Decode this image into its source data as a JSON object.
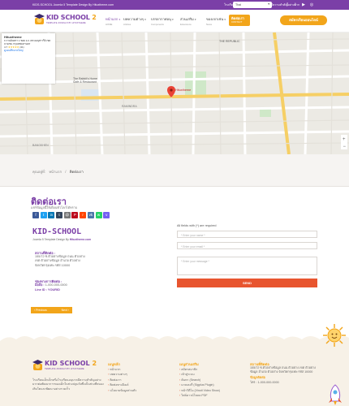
{
  "topbar": {
    "message": "KIDS-SCHOOL Joomla 5 Template Design By Hituxtheme.com",
    "promo": "โรงเรียนเด็กเล็ก หรือโรงเรียนอนุบาล มีความสำคัญอย่างมาก",
    "language": "Thai"
  },
  "header": {
    "logo_name": "KID SCHOOL",
    "logo_number": "2",
    "logo_tagline": "TEMPLATE JOOMLA 5 BY HITUXTHEME",
    "nav": [
      {
        "label": "หน้าแรก",
        "sub": "HOME"
      },
      {
        "label": "บทความต่างๆ",
        "sub": "Articles"
      },
      {
        "label": "บรรยากาศอนุ",
        "sub": "Components"
      },
      {
        "label": "ส่วนเสริม",
        "sub": "Extensions"
      },
      {
        "label": "ของเขาเช่น",
        "sub": "News"
      }
    ],
    "contact_label": "ติดต่อเรา",
    "contact_sub": "CONTACT",
    "online_button": "สมัครเรียนออนไลน์"
  },
  "map": {
    "place_name": "Hituxtheme",
    "place_address": "ถ.รามอินทรา 1 ซอย 1/1 แขวงอนุสาวรีย์ เขตบางเขน กรุงเทพมหานคร",
    "rating": "4.7",
    "reviews": "(41)",
    "view_larger": "ดูแผนที่ขนาดใหญ่",
    "labels": [
      "THE REPUBLIC",
      "Hituxtheme",
      "The Rabbit's Home",
      "Cafe & Restaurant",
      "RAMINDRA",
      "BANGKHEN"
    ]
  },
  "breadcrumb": {
    "items": [
      "คุณอยู่ที่:",
      "หน้าแรก",
      "/",
      "ติดต่อเรา"
    ]
  },
  "page": {
    "title": "ติดต่อเรา",
    "share_label": "แชร์ข้อมูลนี้ให้เพื่อนทั่วโลกได้ทราบ",
    "share_icons": [
      {
        "name": "facebook-icon",
        "glyph": "f",
        "color": "#3b5998"
      },
      {
        "name": "twitter-icon",
        "glyph": "t",
        "color": "#1da1f2"
      },
      {
        "name": "linkedin-icon",
        "glyph": "in",
        "color": "#0077b5"
      },
      {
        "name": "tumblr-icon",
        "glyph": "t",
        "color": "#35465c"
      },
      {
        "name": "email-icon",
        "glyph": "@",
        "color": "#777777"
      },
      {
        "name": "pinterest-icon",
        "glyph": "P",
        "color": "#bd081c"
      },
      {
        "name": "reddit-icon",
        "glyph": "r",
        "color": "#ff4500"
      },
      {
        "name": "vk-icon",
        "glyph": "vk",
        "color": "#4a76a8"
      },
      {
        "name": "whatsapp-icon",
        "glyph": "w",
        "color": "#25d366"
      },
      {
        "name": "viber-icon",
        "glyph": "v",
        "color": "#7360f2"
      }
    ],
    "company": "KID-SCHOOL",
    "company_tagline_prefix": "Joomla 5 Template Design By",
    "company_tagline_site": "Hituxtheme.com",
    "address_title": "สถานที่ติดต่อ :",
    "address_lines": [
      "155/72 ซ.ตัวอย่างข้อมูล ถนน ตัวอย่าง",
      "เขต ตัวอย่างข้อมูล อำเภอ ตัวอย่าง",
      "จังหวัดกรุงเทพ รหัส 10000"
    ],
    "contact_title": "ช่องทางการติดต่อ :",
    "phone_label": "มือถือ :",
    "phone": "1-000-000-0000",
    "line_label": "Line ID :",
    "line": "YOURID",
    "pager_prev": "‹ Previous",
    "pager_next": "Next ›"
  },
  "form": {
    "required_note": "All fields with (*) are required",
    "name_placeholder": "* Enter your name *",
    "email_placeholder": "* Enter your email *",
    "message_placeholder": "* Enter your message *",
    "send_label": "SEND"
  },
  "footer": {
    "logo_name": "KID SCHOOL",
    "logo_number": "2",
    "logo_tagline": "TEMPLATE JOOMLA 5 BY HITUXTHEME",
    "description": "โรงเรียนเด็กเล็กหรือโรงเรียนอนุบาลมีความสำคัญอย่างมากต่อพัฒนาการของเด็กในช่วงปฐมวัยซึ่งเป็นช่วงที่สมองเติบโตและพัฒนาอย่างรวดเร็ว",
    "col1_title": "เมนูหลัก",
    "col1_items": [
      "หน้าแรก",
      "บทความต่างๆ",
      "ติดต่อเรา",
      "ติดต่อทางอีเมล์",
      "นโยบายข้อมูลส่วนตัว"
    ],
    "col2_title": "เมนูส่วนเสริม",
    "col2_items": [
      "สมัครสมาชิก",
      "เข้าสู่ระบบ",
      "ค้นหา (Search)",
      "แกลเลอรี่ (Sigplus Plugin)",
      "หน้าวิดีโอ (Vinoti Video Show)",
      "ไฟล์ดาวน์โหลด PDF"
    ],
    "col3_title": "สถานที่ติดต่อ",
    "col3_address": "155/72 ซ.ตัวอย่างข้อมูล ถนน ตัวอย่าง เขต ตัวอย่างข้อมูล อำเภอ ตัวอย่าง จังหวัดกรุงเทพ รหัส 10000",
    "col3_contact_title": "ข้อมูลติดต่อ",
    "col3_phone": "โทร : 1-000-000-0000"
  },
  "colors": {
    "brand_purple": "#7b3fa7",
    "accent_orange": "#f2a51a",
    "send_red": "#e8552f"
  }
}
